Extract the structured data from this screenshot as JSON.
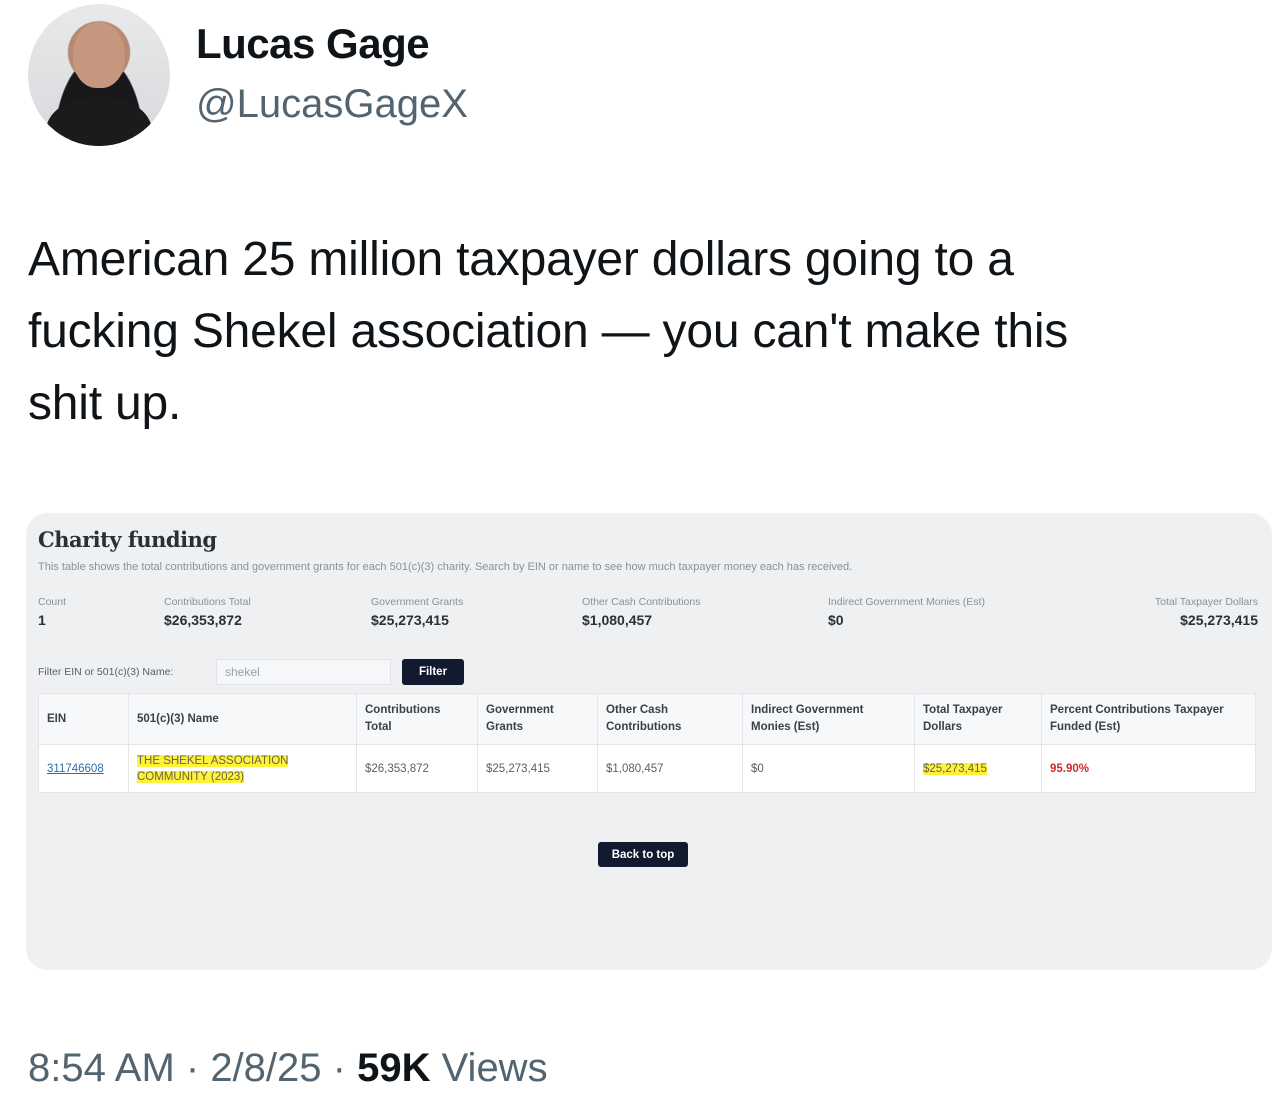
{
  "author": {
    "name": "Lucas Gage",
    "handle": "@LucasGageX"
  },
  "tweet": {
    "line1": "American 25 million taxpayer dollars going to a",
    "line2": "fucking Shekel association — you can't make this",
    "line3": "shit up."
  },
  "card": {
    "title": "Charity funding",
    "description": "This table shows the total contributions and government grants for each 501(c)(3) charity. Search by EIN or name to see how much taxpayer money each has received.",
    "stats": [
      {
        "label": "Count",
        "value": "1"
      },
      {
        "label": "Contributions Total",
        "value": "$26,353,872"
      },
      {
        "label": "Government Grants",
        "value": "$25,273,415"
      },
      {
        "label": "Other Cash Contributions",
        "value": "$1,080,457"
      },
      {
        "label": "Indirect Government Monies (Est)",
        "value": "$0"
      },
      {
        "label": "Total Taxpayer Dollars",
        "value": "$25,273,415"
      }
    ],
    "filter": {
      "label": "Filter EIN or 501(c)(3) Name:",
      "value": "shekel",
      "button": "Filter"
    },
    "table": {
      "headers": [
        "EIN",
        "501(c)(3) Name",
        "Contributions Total",
        "Government Grants",
        "Other Cash Contributions",
        "Indirect Government Monies (Est)",
        "Total Taxpayer Dollars",
        "Percent Contributions Taxpayer Funded (Est)"
      ],
      "rows": [
        [
          "311746608",
          "THE SHEKEL ASSOCIATION COMMUNITY (2023)",
          "$26,353,872",
          "$25,273,415",
          "$1,080,457",
          "$0",
          "$25,273,415",
          "95.90%"
        ]
      ]
    },
    "back_to_top": "Back to top"
  },
  "meta": {
    "time": "8:54 AM",
    "date": "2/8/25",
    "views_count": "59K",
    "views_label": "Views"
  },
  "colors": {
    "highlight": "#fff23a",
    "percent": "#d22b2b",
    "button": "#111a2e",
    "link": "#2a6fb3"
  }
}
